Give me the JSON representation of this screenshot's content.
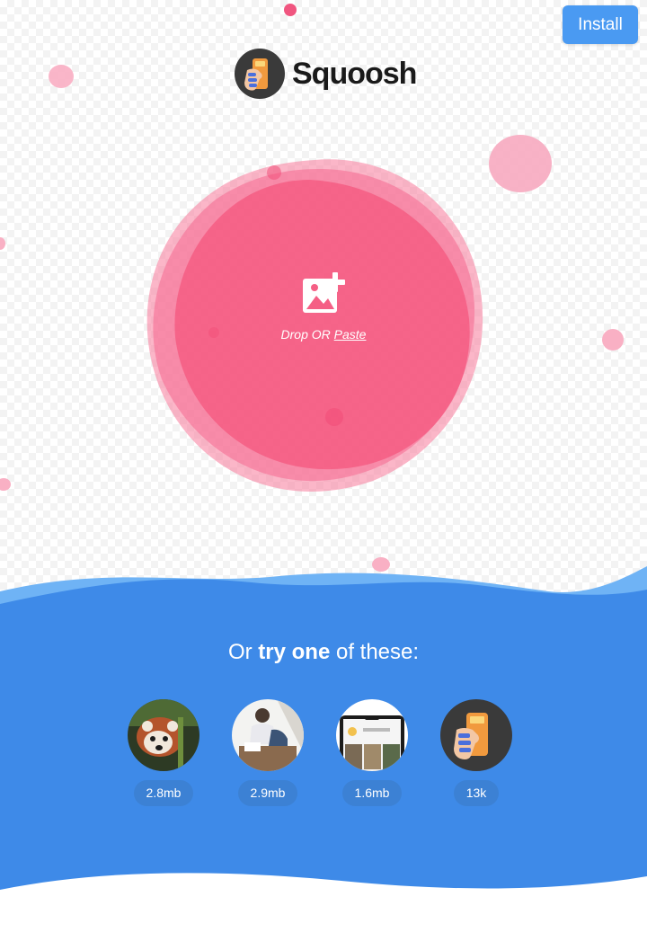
{
  "header": {
    "install_label": "Install"
  },
  "logo": {
    "text": "Squoosh",
    "icon": "squoosh-hand-logo-icon"
  },
  "drop_zone": {
    "icon": "add-image-icon",
    "drop_or_text": "Drop OR",
    "paste_label": "Paste"
  },
  "demos": {
    "heading_prefix": "Or",
    "heading_bold": "try one",
    "heading_suffix": "of these:",
    "items": [
      {
        "image": "red-panda-photo",
        "size": "2.8mb"
      },
      {
        "image": "people-at-table-photo",
        "size": "2.9mb"
      },
      {
        "image": "phone-screenshot",
        "size": "1.6mb"
      },
      {
        "image": "squoosh-logo-image",
        "size": "13k"
      }
    ]
  },
  "colors": {
    "accent_blue": "#4a9af2",
    "wave_blue": "#3e8ae8",
    "blob_pink": "#f55f85",
    "badge_blue": "#3c81d4"
  }
}
